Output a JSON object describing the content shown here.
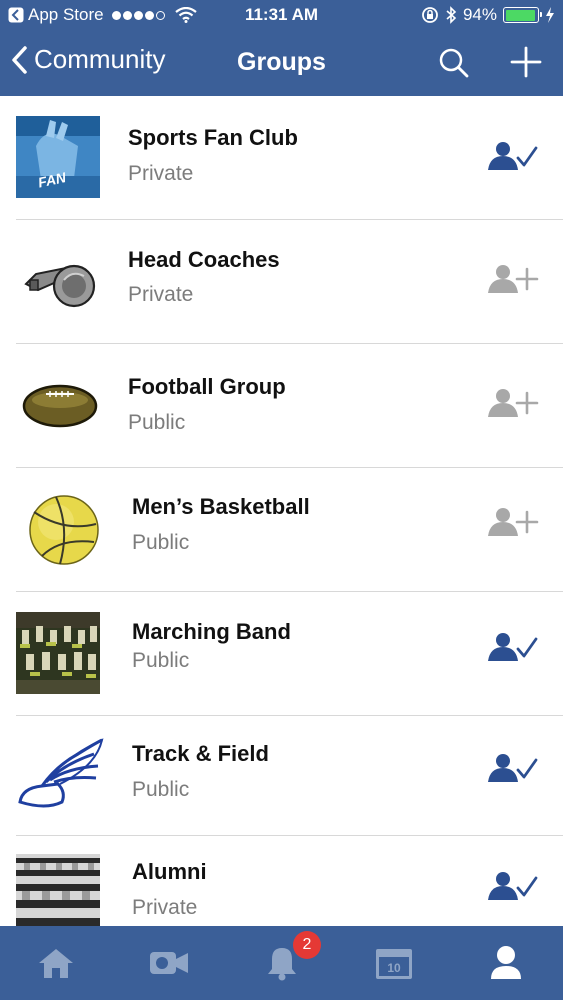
{
  "status_bar": {
    "back_app": "App Store",
    "time": "11:31 AM",
    "battery": "94%",
    "signal_bars_filled": 4,
    "signal_bars_total": 5
  },
  "nav": {
    "back_label": "Community",
    "title": "Groups"
  },
  "groups": [
    {
      "name": "Sports Fan Club",
      "privacy": "Private",
      "joined": true
    },
    {
      "name": "Head Coaches",
      "privacy": "Private",
      "joined": false
    },
    {
      "name": "Football Group",
      "privacy": "Public",
      "joined": false
    },
    {
      "name": "Men’s Basketball",
      "privacy": "Public",
      "joined": false
    },
    {
      "name": "Marching Band",
      "privacy": "Public",
      "joined": true
    },
    {
      "name": "Track & Field",
      "privacy": "Public",
      "joined": true
    },
    {
      "name": "Alumni",
      "privacy": "Private",
      "joined": true
    }
  ],
  "thumb_text": {
    "fan": "FAN",
    "calendar_day": "10"
  },
  "tab_bar": {
    "notifications_badge": "2",
    "active_tab": "profile"
  },
  "colors": {
    "brand_blue": "#3b5f98",
    "joined_icon": "#2c4f91",
    "not_joined_icon": "#a8a8a8",
    "badge_red": "#e53935",
    "tab_inactive": "#8fa5c6",
    "tab_active": "#ffffff"
  }
}
